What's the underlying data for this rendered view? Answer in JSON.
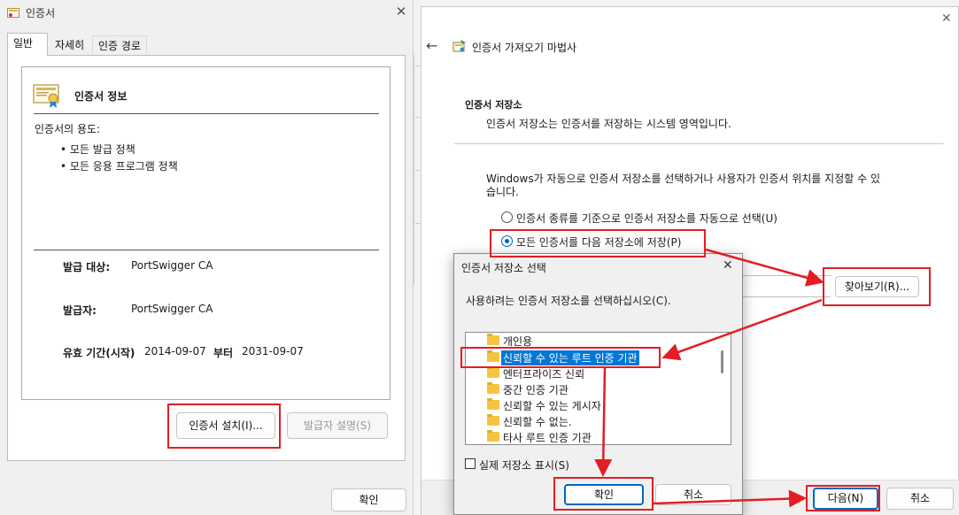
{
  "cert_window": {
    "title": "인증서",
    "tabs": [
      "일반",
      "자세히",
      "인증 경로"
    ],
    "info_title": "인증서 정보",
    "purpose_label": "인증서의 용도:",
    "purposes": [
      "• 모든 발급 정책",
      "• 모든 응용 프로그램 정책"
    ],
    "issued_to_label": "발급 대상:",
    "issued_to": "PortSwigger CA",
    "issued_by_label": "발급자:",
    "issued_by": "PortSwigger CA",
    "valid_label": "유효 기간(시작)",
    "valid_from": "2014-09-07",
    "valid_to_label": "부터",
    "valid_to": "2031-09-07",
    "install_button": "인증서 설치(I)...",
    "issuer_stmt_button": "발급자 설명(S)",
    "ok_button": "확인"
  },
  "wizard": {
    "title": "인증서 가져오기 마법사",
    "section_title": "인증서 저장소",
    "section_desc": "인증서 저장소는 인증서를 저장하는 시스템 영역입니다.",
    "body_text_1": "Windows가 자동으로 인증서 저장소를 선택하거나 사용자가 인증서 위치를 지정할 수 있",
    "body_text_2": "습니다.",
    "radio_auto": "인증서 종류를 기준으로 인증서 저장소를 자동으로 선택(U)",
    "radio_manual": "모든 인증서를 다음 저장소에 저장(P)",
    "browse_button": "찾아보기(R)...",
    "next_button": "다음(N)",
    "cancel_button": "취소"
  },
  "store_dialog": {
    "title": "인증서 저장소 선택",
    "prompt": "사용하려는 인증서 저장소를 선택하십시오(C).",
    "stores": [
      "개인용",
      "신뢰할 수 있는 루트 인증 기관",
      "엔터프라이즈 신뢰",
      "중간 인증 기관",
      "신뢰할 수 있는 게시자",
      "신뢰할 수 없는.",
      "타사 루트 인증 기관"
    ],
    "selected_index": 1,
    "show_physical_label": "실제 저장소 표시(S)",
    "show_physical_checked": false,
    "ok_button": "확인",
    "cancel_button": "취소"
  },
  "colors": {
    "annotation_red": "#e21e24",
    "selection_blue": "#0078d7",
    "primary_border": "#0067c0",
    "folder_yellow": "#f5c542"
  }
}
